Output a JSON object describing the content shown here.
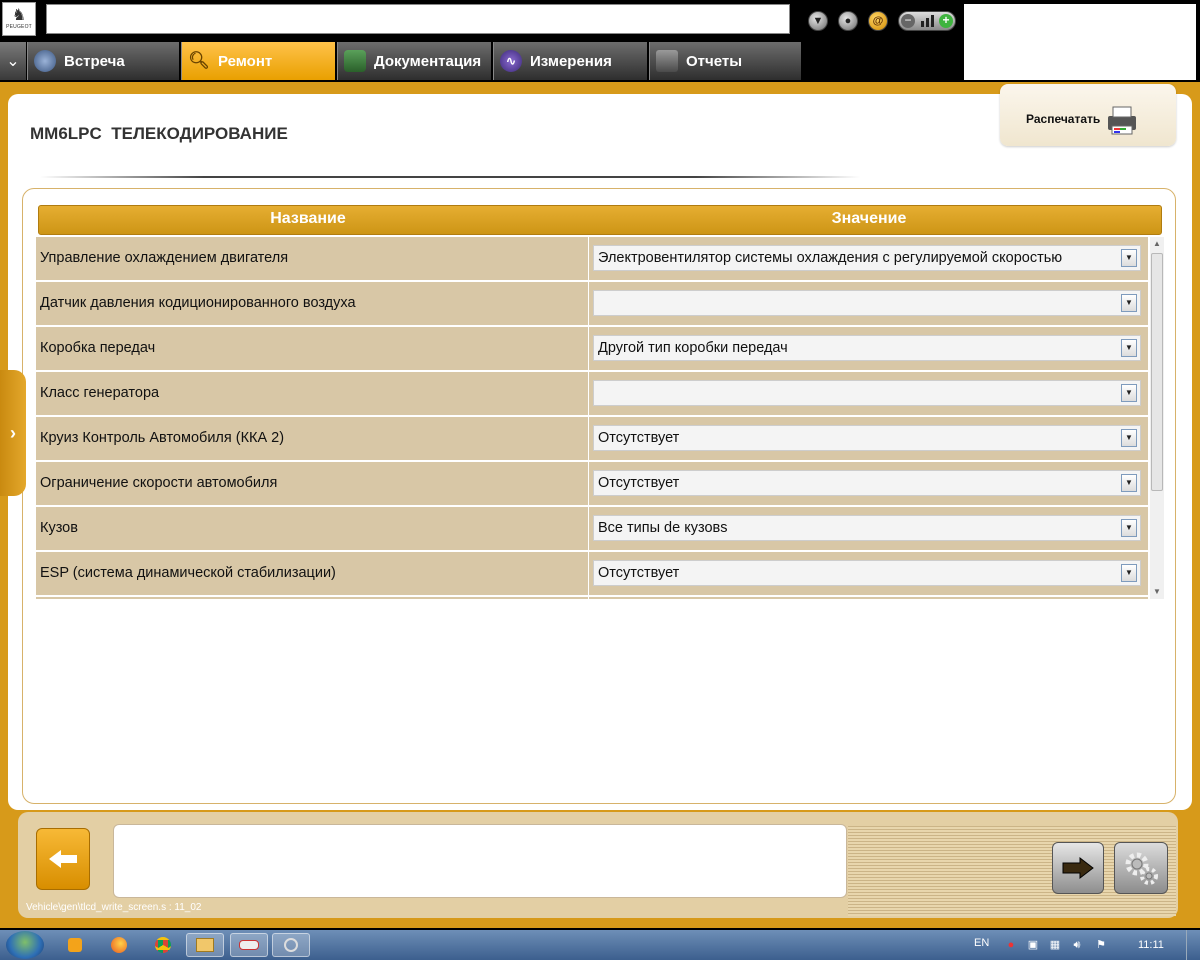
{
  "brand": {
    "logo_text": "PEUGEOT"
  },
  "tabs": [
    {
      "label": "Встреча",
      "active": false
    },
    {
      "label": "Ремонт",
      "active": true
    },
    {
      "label": "Документация",
      "active": false
    },
    {
      "label": "Измерения",
      "active": false
    },
    {
      "label": "Отчеты",
      "active": false
    }
  ],
  "page": {
    "title": "MM6LPC  ТЕЛЕКОДИРОВАНИЕ",
    "print_label": "Распечатать"
  },
  "table": {
    "headers": {
      "name": "Название",
      "value": "Значение"
    },
    "rows": [
      {
        "name": "Управление охлаждением двигателя",
        "value": "Электровентилятор системы охлаждения с регулируемой скоростью"
      },
      {
        "name": "Датчик давления кодиционированного воздуха",
        "value": ""
      },
      {
        "name": "Коробка передач",
        "value": "Другой тип коробки передач"
      },
      {
        "name": "Класс генератора",
        "value": ""
      },
      {
        "name": "Круиз Контроль Автомобиля (ККА 2)",
        "value": "Отсутствует"
      },
      {
        "name": "Ограничение скорости автомобиля",
        "value": "Отсутствует"
      },
      {
        "name": "Кузов",
        "value": "Все типы de кузовs"
      },
      {
        "name": "ESP (система динамической стабилизации)",
        "value": "Отсутствует"
      }
    ]
  },
  "footer": {
    "path": "Vehicle\\gen\\tlcd_write_screen.s : 11_02"
  },
  "taskbar": {
    "lang": "EN",
    "clock": "11:11"
  },
  "colors": {
    "accent": "#d79a1a",
    "row_bg": "#d8c7a6"
  }
}
